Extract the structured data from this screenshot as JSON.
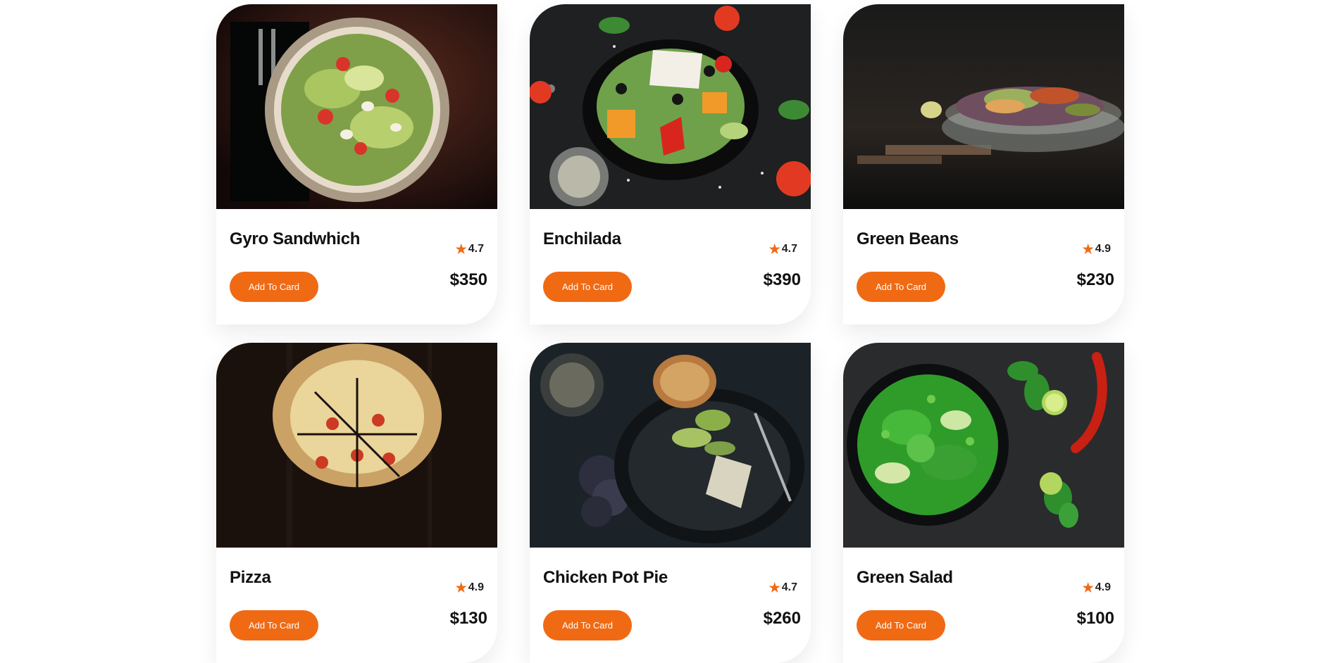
{
  "accent_color": "#f06a14",
  "cards": [
    {
      "name": "Gyro Sandwhich",
      "rating": "4.7",
      "price": "$350",
      "button_label": "Add To Card",
      "image": "caesar-salad-plate-photo"
    },
    {
      "name": "Enchilada",
      "rating": "4.7",
      "price": "$390",
      "button_label": "Add To Card",
      "image": "greek-salad-bowl-photo"
    },
    {
      "name": "Green Beans",
      "rating": "4.9",
      "price": "$230",
      "button_label": "Add To Card",
      "image": "mixed-salad-glass-bowl-photo"
    },
    {
      "name": "Pizza",
      "rating": "4.9",
      "price": "$130",
      "button_label": "Add To Card",
      "image": "pizza-on-wood-photo"
    },
    {
      "name": "Chicken Pot Pie",
      "rating": "4.7",
      "price": "$260",
      "button_label": "Add To Card",
      "image": "chicken-avocado-plate-photo"
    },
    {
      "name": "Green Salad",
      "rating": "4.9",
      "price": "$100",
      "button_label": "Add To Card",
      "image": "green-salad-bowl-photo"
    }
  ]
}
